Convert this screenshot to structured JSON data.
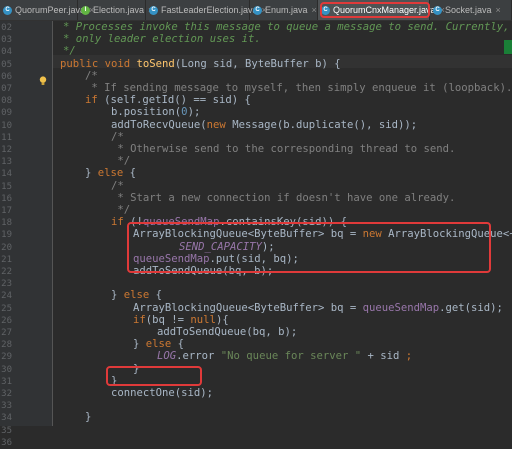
{
  "tabs": [
    {
      "label": "QuorumPeer.java",
      "icon": "c-class-icon",
      "color": "#3592c4",
      "active": false
    },
    {
      "label": "Election.java",
      "icon": "i-interface-icon",
      "color": "#62b543",
      "active": false
    },
    {
      "label": "FastLeaderElection.java",
      "icon": "c-class-icon",
      "color": "#3592c4",
      "active": false
    },
    {
      "label": "Enum.java",
      "icon": "c-class-icon",
      "color": "#3592c4",
      "active": false
    },
    {
      "label": "QuorumCnxManager.java",
      "icon": "c-class-icon",
      "color": "#3592c4",
      "active": true
    },
    {
      "label": "Socket.java",
      "icon": "c-class-icon",
      "color": "#3592c4",
      "active": false
    }
  ],
  "line_numbers": [
    "02",
    "03",
    "04",
    "05",
    "06",
    "07",
    "08",
    "09",
    "10",
    "11",
    "12",
    "13",
    "14",
    "15",
    "16",
    "17",
    "18",
    "19",
    "20",
    "21",
    "22",
    "23",
    "24",
    "25",
    "26",
    "27",
    "28",
    "29",
    "30",
    "31",
    "32",
    "33",
    "34",
    "35",
    "36"
  ],
  "code": {
    "l02": "* Processes invoke this message to queue a message to send. Currently,",
    "l03": "* only leader election uses it.",
    "l04": "*/",
    "l05a": "public void ",
    "l05b": "toSend",
    "l05c": "(Long sid, ByteBuffer b) {",
    "l06": "/*",
    "l07": " * If sending message to myself, then simply enqueue it (loopback).",
    "l08a": "if ",
    "l08b": "(self.getId() == sid) {",
    "l09a": "b.position(",
    "l09b": "0",
    "l09c": ");",
    "l10a": "addToRecvQueue(",
    "l10b": "new ",
    "l10c": "Message(b.duplicate(), sid));",
    "l11": "/*",
    "l12": " * Otherwise send to the corresponding thread to send.",
    "l13": " */",
    "l14a": "} ",
    "l14b": "else ",
    "l14c": "{",
    "l15": "/*",
    "l16": " * Start a new connection if doesn't have one already.",
    "l17": " */",
    "l18a": "if ",
    "l18b": "(!",
    "l18c": "queueSendMap",
    "l18d": ".containsKey(sid)) {",
    "l19a": "ArrayBlockingQueue<ByteBuffer> bq = ",
    "l19b": "new ",
    "l19c": "ArrayBlockingQueue<~>(",
    "l20": "SEND_CAPACITY",
    "l20b": ");",
    "l21a": "queueSendMap",
    "l21b": ".put(sid, bq);",
    "l22": "addToSendQueue(bq, b);",
    "l23": "",
    "l24a": "} ",
    "l24b": "else ",
    "l24c": "{",
    "l25a": "ArrayBlockingQueue<ByteBuffer> bq = ",
    "l25b": "queueSendMap",
    "l25c": ".get(sid);",
    "l26a": "if",
    "l26b": "(bq != ",
    "l26c": "null",
    "l26d": "){",
    "l27": "addToSendQueue(bq, b);",
    "l28a": "} ",
    "l28b": "else ",
    "l28c": "{",
    "l29a": "LOG",
    "l29b": ".error ",
    "l29c": "\"No queue for server \"",
    "l29d": " + sid ",
    "l29e": ";",
    "l30": "}",
    "l31": "}",
    "l32": "connectOne(sid);",
    "l33": "",
    "l34": "}",
    "l35": "}",
    "l36": ""
  },
  "colors": {
    "background": "#2b2b2b",
    "keyword": "#cc7832",
    "comment": "#808080",
    "javadoc": "#629755",
    "method": "#ffc66d",
    "number": "#6897bb",
    "string": "#6a8759",
    "field": "#9876aa",
    "annotation_box": "#e03a3a"
  }
}
